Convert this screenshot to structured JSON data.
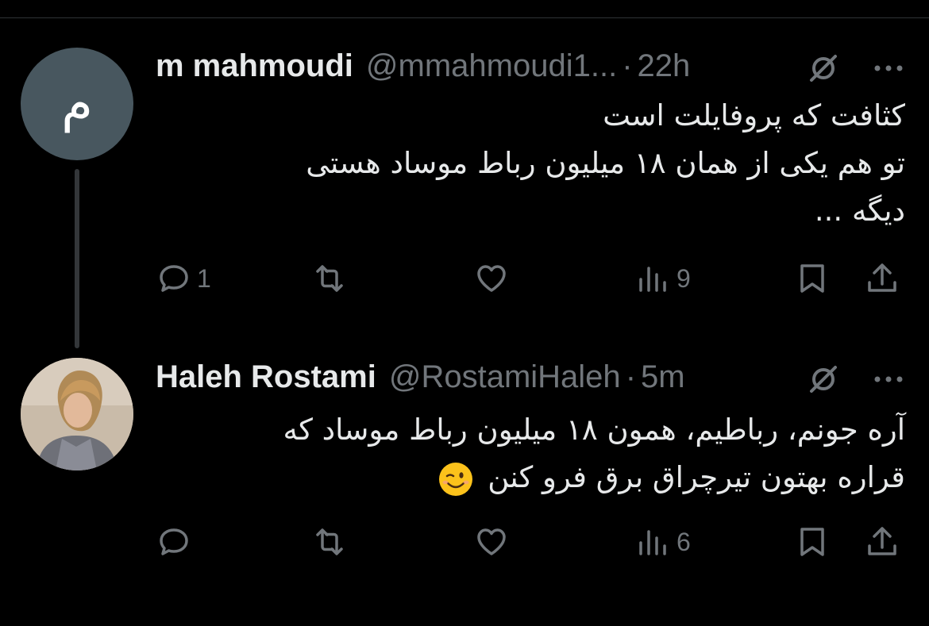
{
  "tweets": [
    {
      "avatar_letter": "م",
      "name": "m mahmoudi",
      "handle": "@mmahmoudi1...",
      "separator": "·",
      "time": "22h",
      "lines": [
        "کثافت که پروفایلت است",
        "تو هم یکی از همان ۱۸ میلیون رباط موساد هستی",
        "دیگه ..."
      ],
      "actions": {
        "replies": "1",
        "retweets": "",
        "likes": "",
        "views": "9"
      }
    },
    {
      "name": "Haleh Rostami",
      "handle": "@RostamiHaleh",
      "separator": "·",
      "time": "5m",
      "lines": [
        "آره جونم، رباطیم، همون ۱۸ میلیون رباط موساد که",
        "قراره بهتون تیرچراق برق فرو کنن"
      ],
      "emoji": "winking-face",
      "actions": {
        "replies": "",
        "retweets": "",
        "likes": "",
        "views": "6"
      }
    }
  ],
  "colors": {
    "background": "#000000",
    "text": "#e7e9ea",
    "muted": "#71767b",
    "thread_line": "#333639",
    "avatar_bg": "#48575f"
  }
}
